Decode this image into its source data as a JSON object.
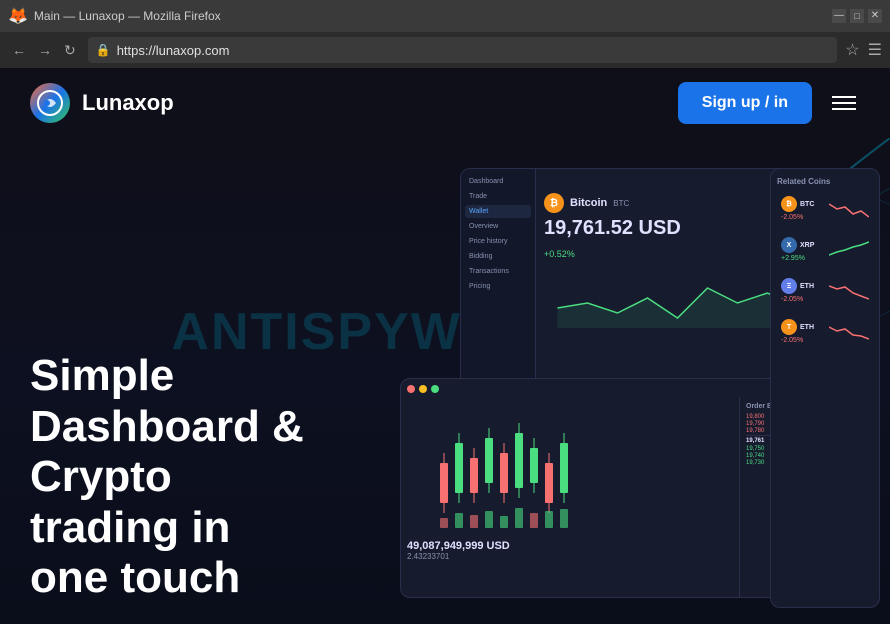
{
  "browser": {
    "title": "Main — Lunaxop — Mozilla Firefox",
    "url": "https://lunaxop.com",
    "favicon": "🦊"
  },
  "nav": {
    "logo_text": "Lunaxop",
    "signup_label": "Sign up / in",
    "hamburger_label": "Menu"
  },
  "hero": {
    "headline_line1": "Simple",
    "headline_line2": "Dashboard &",
    "headline_line3": "Crypto",
    "headline_line4": "trading in",
    "headline_line5": "one touch"
  },
  "watermark": "ANTISPYWARE.COM",
  "dashboard": {
    "btc_name": "Bitcoin",
    "btc_ticker": "BTC",
    "btc_price": "19,761.52 USD",
    "btc_change": "+0.52%",
    "sidebar_items": [
      "Dashboard",
      "Trade",
      "Wallet",
      "Overview",
      "Price history",
      "Bidding",
      "Transactions",
      "Pricing"
    ],
    "active_item": "Wallet",
    "related_title": "Related Coins",
    "trade_price": "49,087,949,999 USD",
    "alt_price": "2.43233701",
    "coins": [
      {
        "name": "BTC",
        "color": "#f7931a",
        "change": "-2.05%",
        "positive": false
      },
      {
        "name": "XRP",
        "color": "#346aa9",
        "change": "+2.95%",
        "positive": true
      },
      {
        "name": "ETH",
        "color": "#627eea",
        "change": "-2.05%",
        "positive": false
      },
      {
        "name": "ETH",
        "color": "#627eea",
        "change": "-2.05%",
        "positive": false
      }
    ]
  },
  "colors": {
    "accent_blue": "#1a73e8",
    "positive": "#4ade80",
    "negative": "#f87171",
    "bg_dark": "#0f0f1a",
    "card_bg": "#161b2e"
  }
}
